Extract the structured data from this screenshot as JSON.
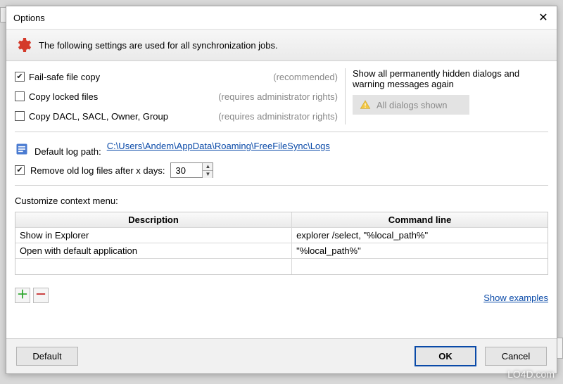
{
  "title": "Options",
  "banner": "The following settings are used for all synchronization jobs.",
  "options": {
    "failsafe": {
      "label": "Fail-safe file copy",
      "hint": "(recommended)",
      "checked": true
    },
    "locked": {
      "label": "Copy locked files",
      "hint": "(requires administrator rights)",
      "checked": false
    },
    "dacl": {
      "label": "Copy DACL, SACL, Owner, Group",
      "hint": "(requires administrator rights)",
      "checked": false
    }
  },
  "hidden_dialogs": {
    "text": "Show all permanently hidden dialogs and warning messages again",
    "button": "All dialogs shown"
  },
  "log": {
    "label": "Default log path:",
    "path": "C:\\Users\\Andem\\AppData\\Roaming\\FreeFileSync\\Logs",
    "remove_label": "Remove old log files after x days:",
    "remove_checked": true,
    "days": "30"
  },
  "context_menu": {
    "label": "Customize context menu:",
    "columns": {
      "desc": "Description",
      "cmd": "Command line"
    },
    "rows": [
      {
        "desc": "Show in Explorer",
        "cmd": "explorer /select, \"%local_path%\""
      },
      {
        "desc": "Open with default application",
        "cmd": "\"%local_path%\""
      }
    ],
    "show_examples": "Show examples"
  },
  "buttons": {
    "default": "Default",
    "ok": "OK",
    "cancel": "Cancel"
  },
  "watermark": "LO4D.com"
}
